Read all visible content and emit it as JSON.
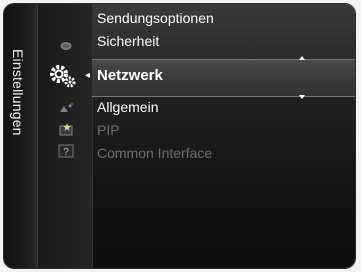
{
  "menu": {
    "title": "Einstellungen",
    "items": [
      {
        "label": "Sendungsoptionen",
        "enabled": true
      },
      {
        "label": "Sicherheit",
        "enabled": true
      },
      {
        "label": "Netzwerk",
        "enabled": true,
        "selected": true
      },
      {
        "label": "Allgemein",
        "enabled": true
      },
      {
        "label": "PIP",
        "enabled": false
      },
      {
        "label": "Common Interface",
        "enabled": false
      }
    ]
  },
  "icons": [
    "satellite-dish-icon",
    "settings-gear-icon",
    "antenna-signal-icon",
    "star-sparkle-icon",
    "help-question-icon"
  ]
}
